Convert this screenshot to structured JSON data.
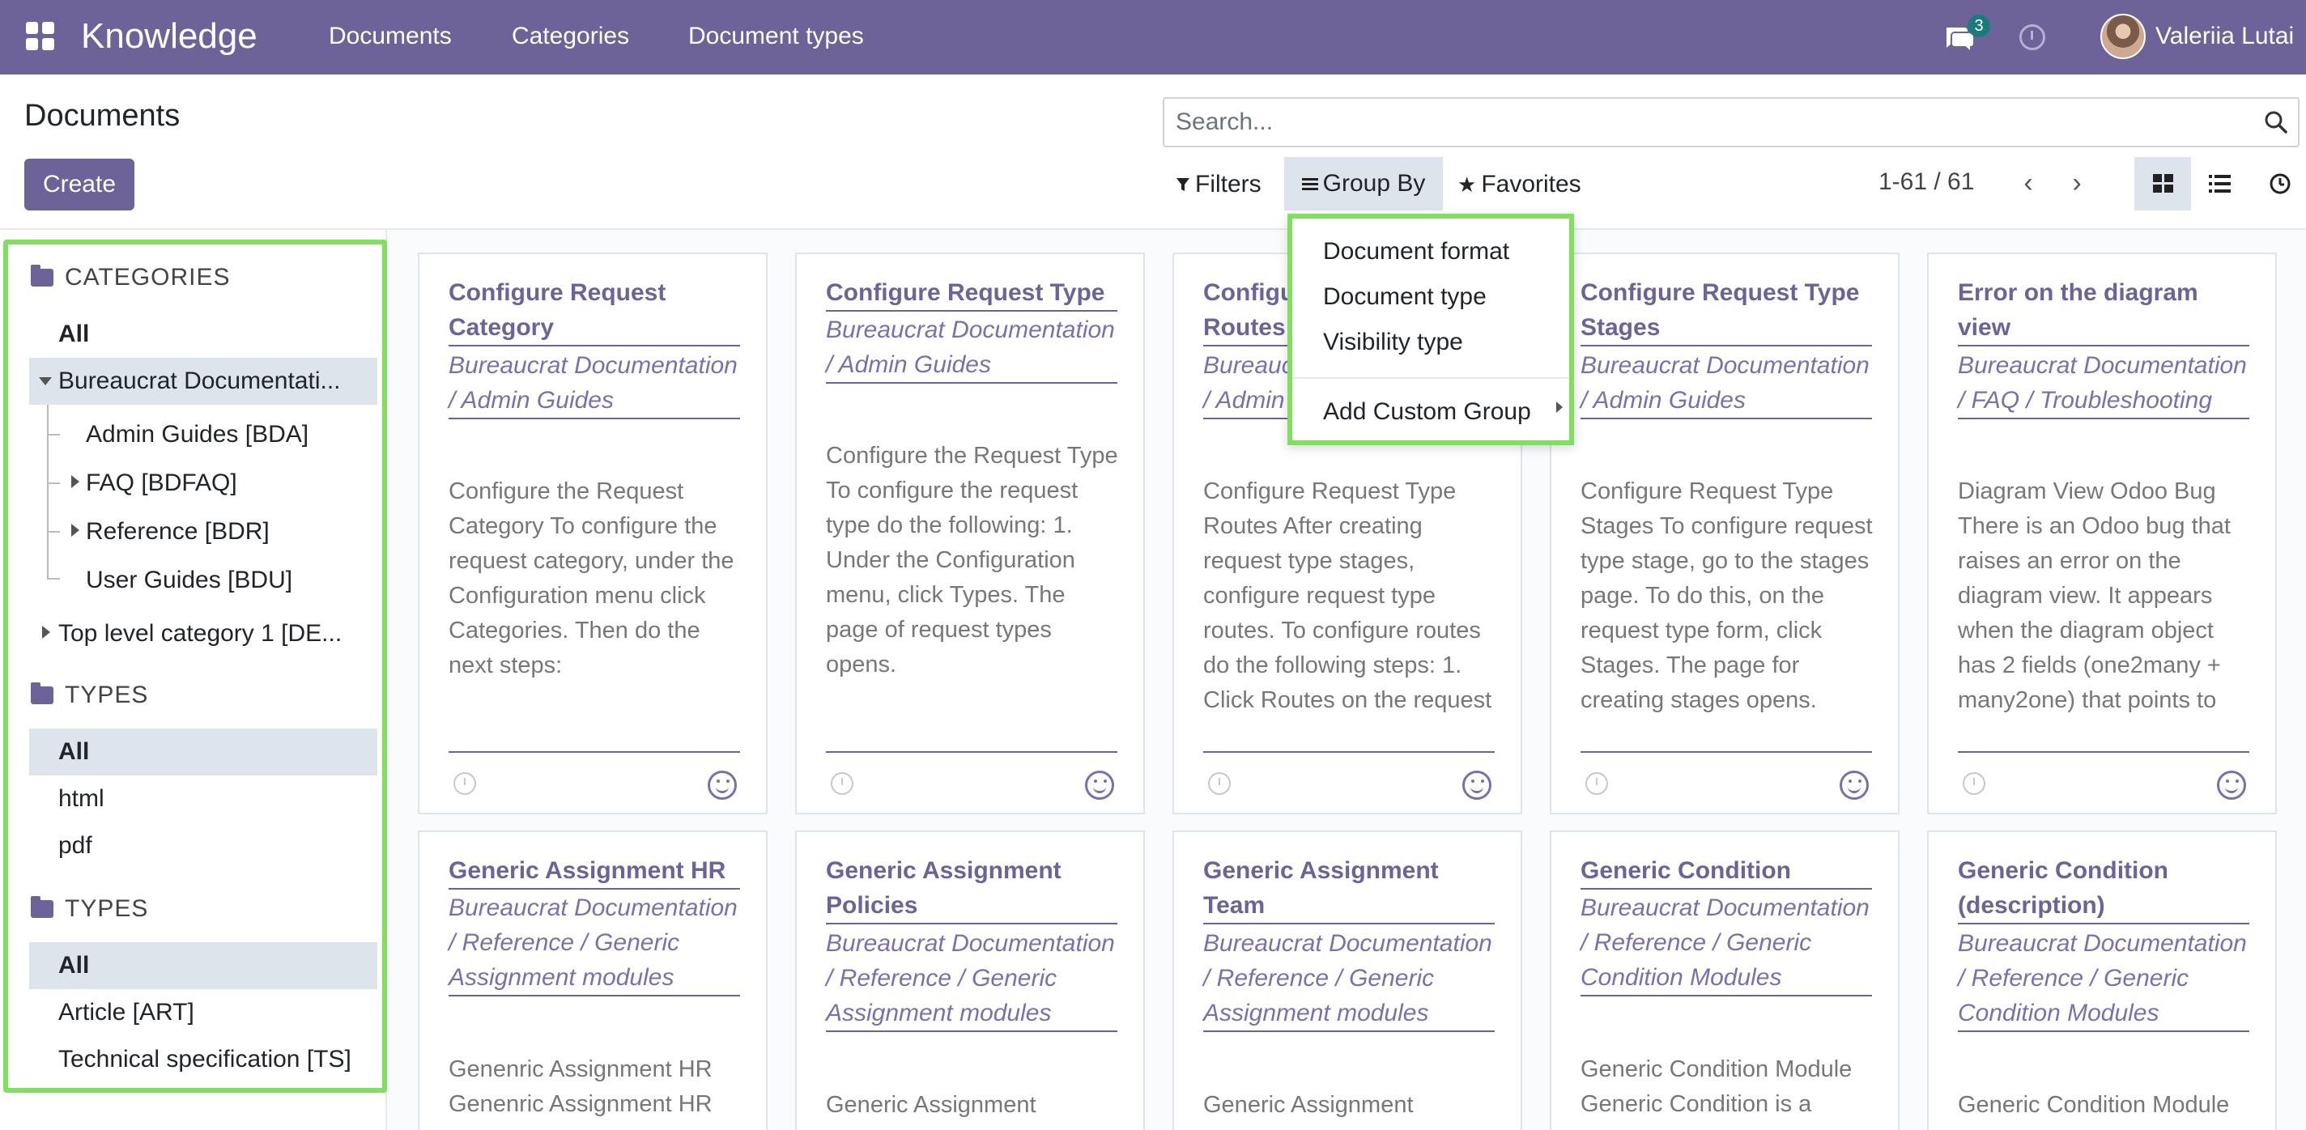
{
  "navbar": {
    "app_name": "Knowledge",
    "menu": [
      "Documents",
      "Categories",
      "Document types"
    ],
    "messages_count": "3",
    "user_name": "Valeriia Lutai"
  },
  "control_panel": {
    "page_title": "Documents",
    "create_label": "Create",
    "search_placeholder": "Search...",
    "filters_label": "Filters",
    "groupby_label": "Group By",
    "favorites_label": "Favorites",
    "pager": "1-61 / 61"
  },
  "groupby_menu": {
    "items": [
      "Document format",
      "Document type",
      "Visibility type"
    ],
    "custom_group_label": "Add Custom Group"
  },
  "sidebar": {
    "categories_heading": "CATEGORIES",
    "categories": [
      {
        "label": "All"
      },
      {
        "label": "Bureaucrat Documentati..."
      },
      {
        "label": "Admin Guides [BDA]"
      },
      {
        "label": "FAQ [BDFAQ]"
      },
      {
        "label": "Reference [BDR]"
      },
      {
        "label": "User Guides [BDU]"
      },
      {
        "label": "Top level category 1 [DE..."
      }
    ],
    "types_heading": "TYPES",
    "types": [
      "All",
      "html",
      "pdf"
    ],
    "types2_heading": "TYPES",
    "types2": [
      "All",
      "Article [ART]",
      "Technical specification [TS]"
    ]
  },
  "cards": [
    {
      "title": "Configure Request Category",
      "category": "Bureaucrat Documentation / Admin Guides",
      "description": "Configure the Request Category To configure the request category, under the Configuration menu click Categories. Then do the next steps:"
    },
    {
      "title": "Configure Request Type",
      "category": "Bureaucrat Documentation / Admin Guides",
      "description": "Configure the Request Type To configure the request type do the following: 1. Under the Configuration menu, click Types. The page of request types opens."
    },
    {
      "title": "Configure Request Type Routes",
      "category": "Bureaucrat Documentation / Admin Guides",
      "description": "Configure Request Type Routes After creating request type stages, configure request type routes. To configure routes do the following steps: 1. Click Routes on the request type form."
    },
    {
      "title": "Configure Request Type Stages",
      "category": "Bureaucrat Documentation / Admin Guides",
      "description": "Configure Request Type Stages To configure request type stage, go to the stages page. To do this, on the request type form, click Stages. The page for creating stages opens."
    },
    {
      "title": "Error on the diagram view",
      "category": "Bureaucrat Documentation / FAQ / Troubleshooting",
      "description": "Diagram View Odoo Bug There is an Odoo bug that raises an error on the diagram view. It appears when the diagram object has 2 fields (one2many + many2one) that points to related nodes."
    },
    {
      "title": "Generic Assignment HR",
      "category": "Bureaucrat Documentation / Reference / Generic Assignment modules",
      "description": "Genenric Assignment HR Genenric Assignment HR"
    },
    {
      "title": "Generic Assignment Policies",
      "category": "Bureaucrat Documentation / Reference / Generic Assignment modules",
      "description": "Generic Assignment"
    },
    {
      "title": "Generic Assignment Team",
      "category": "Bureaucrat Documentation / Reference / Generic Assignment modules",
      "description": "Generic Assignment"
    },
    {
      "title": "Generic Condition",
      "category": "Bureaucrat Documentation / Reference / Generic Condition Modules",
      "description": "Generic Condition Module Generic Condition is a"
    },
    {
      "title": "Generic Condition (description)",
      "category": "Bureaucrat Documentation / Reference / Generic Condition Modules",
      "description": "Generic Condition Module"
    }
  ],
  "colors": {
    "brand": "#6e6399",
    "highlight": "#7ee05d",
    "selected_bg": "#dde4ec"
  }
}
